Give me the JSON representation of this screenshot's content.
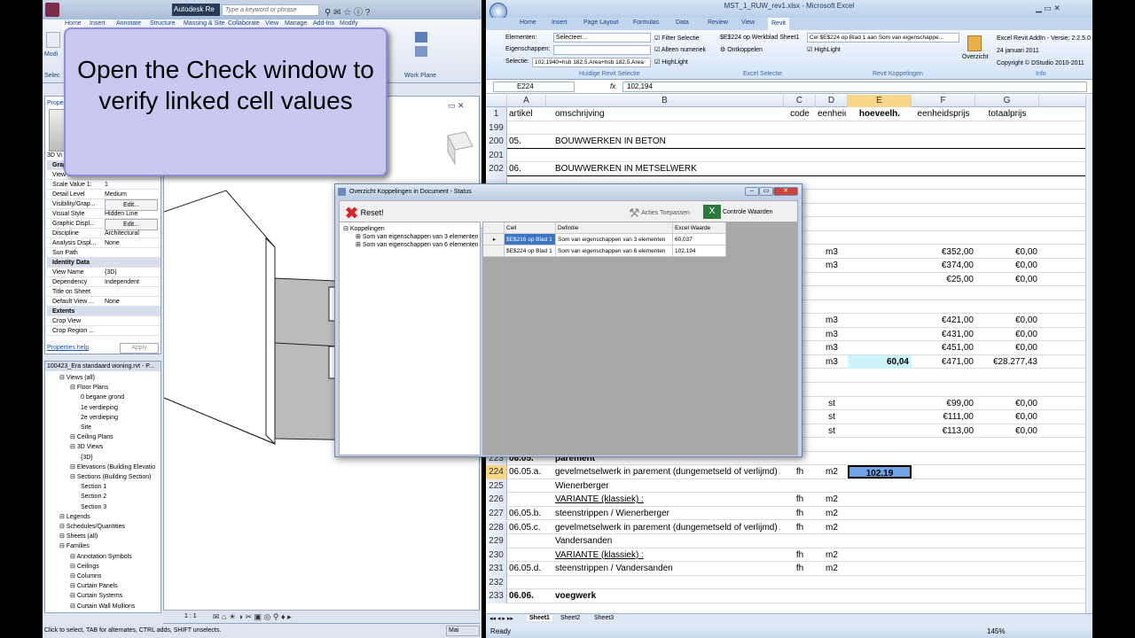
{
  "callout": {
    "text": "Open the Check window to verify linked cell values"
  },
  "revit": {
    "title": "Autodesk Re",
    "search_placeholder": "Type a keyword or phrase",
    "tabs": [
      "Home",
      "Insert",
      "Annotate",
      "Structure",
      "Massing & Site",
      "Collaborate",
      "View",
      "Manage",
      "Add-Ins",
      "Modify"
    ],
    "work_plane": "Work Plane",
    "modify_label": "Modi",
    "select_label": "Selec",
    "properties_label": "Prope",
    "view_type": "3D Vi",
    "properties": [
      {
        "k": "Graph",
        "v": "",
        "sec": true
      },
      {
        "k": "View Sc",
        "v": ""
      },
      {
        "k": "Scale Value  1:",
        "v": "1"
      },
      {
        "k": "Detail Level",
        "v": "Medium"
      },
      {
        "k": "Visibility/Grap...",
        "v": "Edit..."
      },
      {
        "k": "Visual Style",
        "v": "Hidden Line"
      },
      {
        "k": "Graphic Displ...",
        "v": "Edit..."
      },
      {
        "k": "Discipline",
        "v": "Architectural"
      },
      {
        "k": "Analysis Displ...",
        "v": "None"
      },
      {
        "k": "Sun Path",
        "v": ""
      },
      {
        "k": "Identity Data",
        "v": "",
        "sec": true
      },
      {
        "k": "View Name",
        "v": "{3D}"
      },
      {
        "k": "Dependency",
        "v": "Independent"
      },
      {
        "k": "Title on Sheet",
        "v": ""
      },
      {
        "k": "Default View ...",
        "v": "None"
      },
      {
        "k": "Extents",
        "v": "",
        "sec": true
      },
      {
        "k": "Crop View",
        "v": ""
      },
      {
        "k": "Crop Region ...",
        "v": ""
      }
    ],
    "properties_help": "Properties help",
    "apply": "Apply",
    "browser_title": "100423_Era standaard woning.rvt - P...",
    "tree": [
      {
        "t": "Views (all)",
        "d": 1
      },
      {
        "t": "Floor Plans",
        "d": 2
      },
      {
        "t": "0 begane grond",
        "d": 3
      },
      {
        "t": "1e verdieping",
        "d": 3
      },
      {
        "t": "2e verdieping",
        "d": 3
      },
      {
        "t": "Site",
        "d": 3
      },
      {
        "t": "Ceiling Plans",
        "d": 2
      },
      {
        "t": "3D Views",
        "d": 2
      },
      {
        "t": "{3D}",
        "d": 3
      },
      {
        "t": "Elevations (Building Elevatio",
        "d": 2
      },
      {
        "t": "Sections (Building Section)",
        "d": 2
      },
      {
        "t": "Section 1",
        "d": 3
      },
      {
        "t": "Section 2",
        "d": 3
      },
      {
        "t": "Section 3",
        "d": 3
      },
      {
        "t": "Legends",
        "d": 1
      },
      {
        "t": "Schedules/Quantities",
        "d": 1
      },
      {
        "t": "Sheets (all)",
        "d": 1
      },
      {
        "t": "Families",
        "d": 1
      },
      {
        "t": "Annotation Symbols",
        "d": 2
      },
      {
        "t": "Ceilings",
        "d": 2
      },
      {
        "t": "Columns",
        "d": 2
      },
      {
        "t": "Curtain Panels",
        "d": 2
      },
      {
        "t": "Curtain Systems",
        "d": 2
      },
      {
        "t": "Curtain Wall Mullions",
        "d": 2
      }
    ],
    "view_scale": "1 : 1",
    "status": "Click to select, TAB for alternates, CTRL adds, SHIFT unselects.",
    "status_model": "Mai"
  },
  "excel": {
    "title": "MST_1_RUW_rev1.xlsx - Microsoft Excel",
    "tabs": [
      "Home",
      "Insert",
      "Page Layout",
      "Formulas",
      "Data",
      "Review",
      "View",
      "Revit"
    ],
    "elementen_label": "Elementen:",
    "elementen_value": "Selecteer...",
    "eigenschappen_label": "Eigenschappen:",
    "selectie_label": "Selectie:",
    "selectie_value": "102,1940=hsb 182,5.Area+hsb 182,5.Area",
    "filter_selectie": "Filter Selectie",
    "alleen_numeriek": "Alleen numeriek",
    "highlight": "HighLight",
    "group1": "Huidige Revit Selectie",
    "excel_selectie_cell": "$E$224 op Werkblad Sheet1",
    "ontkoppelen": "Ontkoppelen",
    "group2": "Excel Selectie",
    "koppel_cell": "Cel $E$224 op Blad 1 aan Som van eigenschappe...",
    "koppel_highlight": "HighLight",
    "group3": "Revit Koppelingen",
    "overzicht": "Overzicht",
    "info1": "Excel Revit AddIn - Versie: 2.2.5.0",
    "info2": "24 januari 2011",
    "info3": "Copyright © DStudio 2010-2011",
    "group4": "Info",
    "namebox": "E224",
    "formula": "102,194",
    "col_headers": [
      "A",
      "B",
      "C",
      "D",
      "E",
      "F",
      "G"
    ],
    "rows": [
      {
        "n": "1",
        "a": "artikel",
        "b": "omschrijving",
        "c": "code",
        "d": "eenheid",
        "e": "hoeveelh.",
        "f": "eenheidsprijs",
        "g": "totaalprijs",
        "hdr": true
      },
      {
        "n": "199",
        "a": "",
        "b": "",
        "c": "",
        "d": "",
        "e": "",
        "f": "",
        "g": ""
      },
      {
        "n": "200",
        "a": "05.",
        "b": "BOUWWERKEN IN BETON",
        "c": "",
        "d": "",
        "e": "",
        "f": "",
        "g": ""
      },
      {
        "n": "201",
        "a": "",
        "b": "",
        "c": "",
        "d": "",
        "e": "",
        "f": "",
        "g": ""
      },
      {
        "n": "202",
        "a": "06.",
        "b": "BOUWWERKEN IN METSELWERK",
        "c": "",
        "d": "",
        "e": "",
        "f": "",
        "g": ""
      },
      {
        "n": "",
        "a": "",
        "b": "",
        "c": "",
        "d": "",
        "e": "",
        "f": "",
        "g": ""
      },
      {
        "n": "",
        "a": "",
        "b": "",
        "c": "",
        "d": "",
        "e": "",
        "f": "",
        "g": ""
      },
      {
        "n": "",
        "a": "",
        "b": "",
        "c": "",
        "d": "",
        "e": "",
        "f": "",
        "g": ""
      },
      {
        "n": "",
        "a": "",
        "b": "",
        "c": "",
        "d": "",
        "e": "",
        "f": "",
        "g": ""
      },
      {
        "n": "",
        "a": "",
        "b": "",
        "c": "",
        "d": "",
        "e": "",
        "f": "",
        "g": ""
      },
      {
        "n": "",
        "a": "",
        "b": "",
        "c": "",
        "d": "m3",
        "e": "",
        "f": "€352,00",
        "g": "€0,00"
      },
      {
        "n": "",
        "a": "",
        "b": "",
        "c": "",
        "d": "m3",
        "e": "",
        "f": "€374,00",
        "g": "€0,00"
      },
      {
        "n": "",
        "a": "",
        "b": "",
        "c": "",
        "d": "",
        "e": "",
        "f": "€25,00",
        "g": "€0,00"
      },
      {
        "n": "",
        "a": "",
        "b": "",
        "c": "",
        "d": "",
        "e": "",
        "f": "",
        "g": ""
      },
      {
        "n": "",
        "a": "",
        "b": "",
        "c": "",
        "d": "",
        "e": "",
        "f": "",
        "g": ""
      },
      {
        "n": "",
        "a": "",
        "b": "",
        "c": "",
        "d": "m3",
        "e": "",
        "f": "€421,00",
        "g": "€0,00"
      },
      {
        "n": "",
        "a": "",
        "b": "",
        "c": "",
        "d": "m3",
        "e": "",
        "f": "€431,00",
        "g": "€0,00"
      },
      {
        "n": "",
        "a": "",
        "b": "",
        "c": "",
        "d": "m3",
        "e": "",
        "f": "€451,00",
        "g": "€0,00"
      },
      {
        "n": "",
        "a": "",
        "b": "",
        "c": "",
        "d": "m3",
        "e": "60,04",
        "f": "€471,00",
        "g": "€28.277,43",
        "hl": true
      },
      {
        "n": "",
        "a": "",
        "b": "",
        "c": "",
        "d": "",
        "e": "",
        "f": "",
        "g": ""
      },
      {
        "n": "",
        "a": "",
        "b": "",
        "c": "",
        "d": "",
        "e": "",
        "f": "",
        "g": ""
      },
      {
        "n": "",
        "a": "",
        "b": "",
        "c": "",
        "d": "st",
        "e": "",
        "f": "€99,00",
        "g": "€0,00"
      },
      {
        "n": "",
        "a": "",
        "b": "",
        "c": "",
        "d": "st",
        "e": "",
        "f": "€111,00",
        "g": "€0,00"
      },
      {
        "n": "",
        "a": "",
        "b": "",
        "c": "",
        "d": "st",
        "e": "",
        "f": "€113,00",
        "g": "€0,00"
      },
      {
        "n": "",
        "a": "",
        "b": "",
        "c": "",
        "d": "",
        "e": "",
        "f": "",
        "g": ""
      },
      {
        "n": "223",
        "a": "06.05.",
        "b": "parement",
        "c": "",
        "d": "",
        "e": "",
        "f": "",
        "g": "",
        "bold": true
      },
      {
        "n": "224",
        "a": "06.05.a.",
        "b": "gevelmetselwerk in parement (dungemetseld of verlijmd) /",
        "c": "fh",
        "d": "m2",
        "e": "102,19",
        "f": "",
        "g": "",
        "sel": true
      },
      {
        "n": "225",
        "a": "",
        "b": "Wienerberger",
        "c": "",
        "d": "",
        "e": "",
        "f": "",
        "g": ""
      },
      {
        "n": "226",
        "a": "",
        "b": "VARIANTE (klassiek) :",
        "c": "fh",
        "d": "m2",
        "e": "",
        "f": "",
        "g": "",
        "ul": true
      },
      {
        "n": "227",
        "a": "06.05.b.",
        "b": "steenstrippen / Wienerberger",
        "c": "fh",
        "d": "m2",
        "e": "",
        "f": "",
        "g": ""
      },
      {
        "n": "228",
        "a": "06.05.c.",
        "b": "gevelmetselwerk in parement (dungemetseld of verlijmd) /",
        "c": "fh",
        "d": "m2",
        "e": "",
        "f": "",
        "g": ""
      },
      {
        "n": "229",
        "a": "",
        "b": "Vandersanden",
        "c": "",
        "d": "",
        "e": "",
        "f": "",
        "g": ""
      },
      {
        "n": "230",
        "a": "",
        "b": "VARIANTE (klassiek) :",
        "c": "fh",
        "d": "m2",
        "e": "",
        "f": "",
        "g": "",
        "ul": true
      },
      {
        "n": "231",
        "a": "06.05.d.",
        "b": "steenstrippen / Vandersanden",
        "c": "fh",
        "d": "m2",
        "e": "",
        "f": "",
        "g": ""
      },
      {
        "n": "232",
        "a": "",
        "b": "",
        "c": "",
        "d": "",
        "e": "",
        "f": "",
        "g": ""
      },
      {
        "n": "233",
        "a": "06.06.",
        "b": "voegwerk",
        "c": "",
        "d": "",
        "e": "",
        "f": "",
        "g": "",
        "bold": true
      }
    ],
    "sheets": [
      "Sheet1",
      "Sheet2",
      "Sheet3"
    ],
    "status": "Ready",
    "zoom": "145%"
  },
  "dialog": {
    "title": "Overzicht Koppelingen in Document - Status",
    "reset": "Reset!",
    "acties": "Acties Toepassen",
    "controle": "Controle Waarden",
    "tree_root": "Koppelingen",
    "tree_items": [
      "Som van eigenschappen van 3 elementen",
      "Som van eigenschappen van 6 elementen"
    ],
    "headers": [
      "Cell",
      "Definitie",
      "Excel Waarde"
    ],
    "rows": [
      {
        "cell": "$E$216 op Blad 1",
        "def": "Som van eigenschappen van 3 elementen",
        "val": "60,037"
      },
      {
        "cell": "$E$224 op Blad 1",
        "def": "Som van eigenschappen van 6 elementen",
        "val": "102,194"
      }
    ]
  }
}
